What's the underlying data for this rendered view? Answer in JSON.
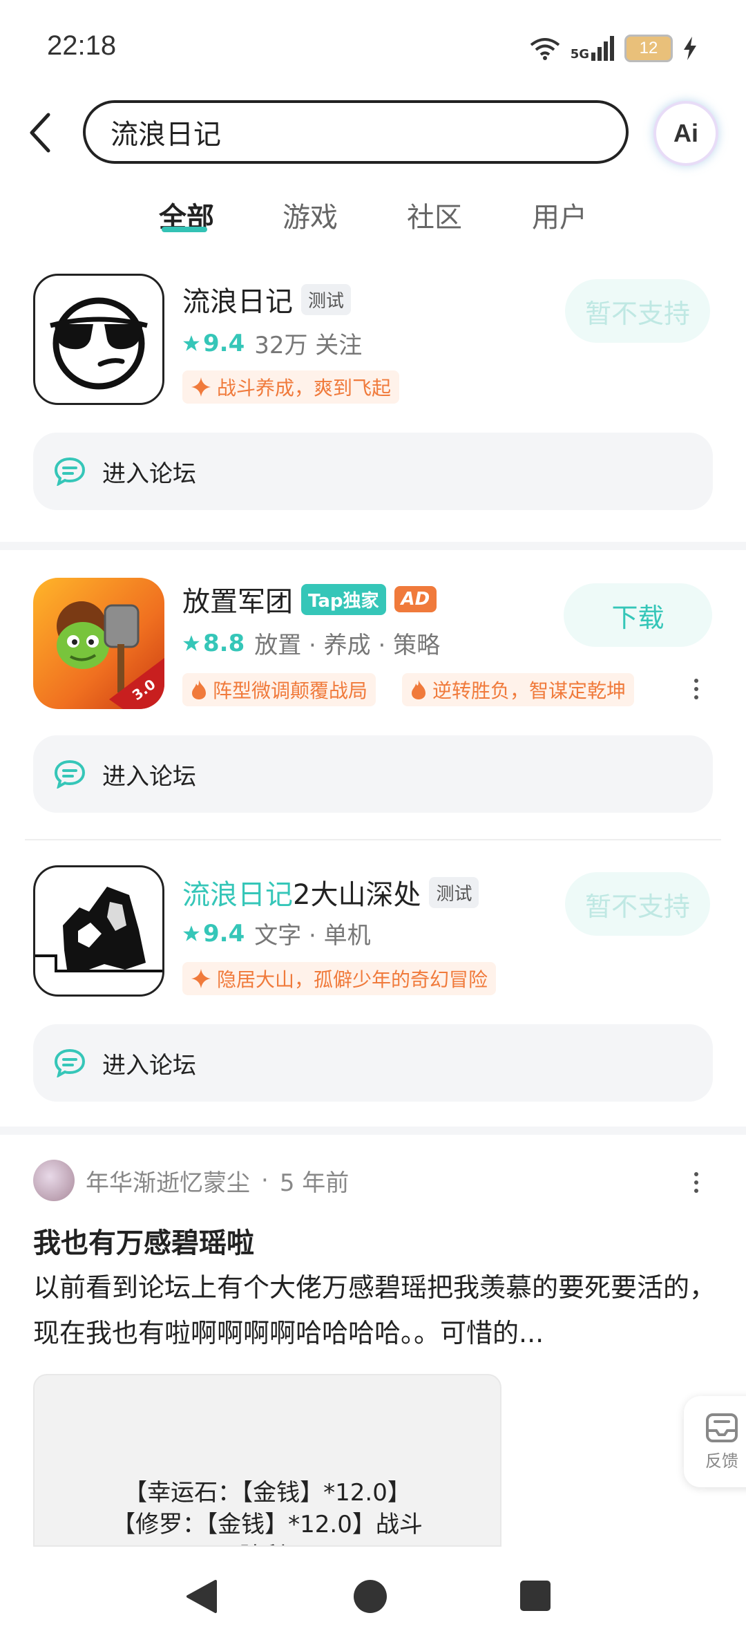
{
  "status_bar": {
    "time": "22:18",
    "network": "5G",
    "battery": "12"
  },
  "search": {
    "query": "流浪日记",
    "ai_label": "Ai"
  },
  "tabs": [
    {
      "label": "全部",
      "active": true
    },
    {
      "label": "游戏",
      "active": false
    },
    {
      "label": "社区",
      "active": false
    },
    {
      "label": "用户",
      "active": false
    }
  ],
  "apps": [
    {
      "title": "流浪日记",
      "tags": [
        "测试"
      ],
      "rating": "9.4",
      "meta": "32万 关注",
      "promos": [
        "战斗养成，爽到飞起"
      ],
      "action": "暂不支持",
      "forum_label": "进入论坛"
    },
    {
      "title": "放置军团",
      "tags": [
        "Tap独家",
        "AD"
      ],
      "rating": "8.8",
      "meta": "放置 · 养成 · 策略",
      "promos": [
        "阵型微调颠覆战局",
        "逆转胜负，智谋定乾坤"
      ],
      "action": "下载",
      "forum_label": "进入论坛"
    },
    {
      "title_highlight": "流浪日记",
      "title_rest": "2大山深处",
      "tags": [
        "测试"
      ],
      "rating": "9.4",
      "meta": "文字 · 单机",
      "promos": [
        "隐居大山，孤僻少年的奇幻冒险"
      ],
      "action": "暂不支持",
      "forum_label": "进入论坛"
    }
  ],
  "post": {
    "author": "年华渐逝忆蒙尘",
    "time": "5 年前",
    "title": "我也有万感碧瑶啦",
    "body": "以前看到论坛上有个大佬万感碧瑶把我羡慕的要死要活的，现在我也有啦啊啊啊啊哈哈哈哈。。可惜的...",
    "image_lines": [
      "【幸运石：【金钱】*12.0】",
      "【修罗：【金钱】*12.0】战斗",
      "胜利!"
    ]
  },
  "feedback_label": "反馈",
  "colors": {
    "accent": "#35c6b8",
    "promo": "#f07a3b"
  }
}
